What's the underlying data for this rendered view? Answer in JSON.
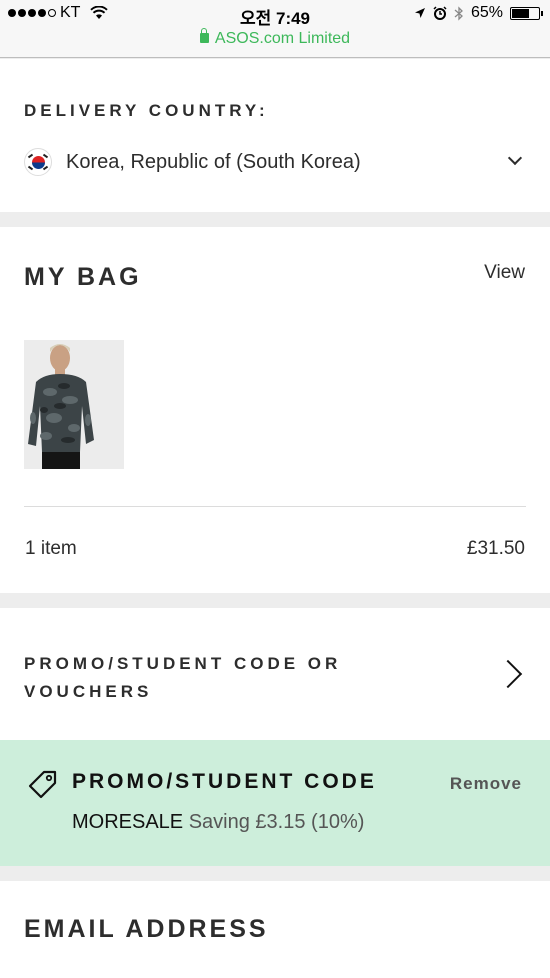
{
  "status_bar": {
    "carrier": "KT",
    "time": "오전 7:49",
    "battery_percent": "65%",
    "battery_level": 0.65,
    "url": "ASOS.com Limited"
  },
  "delivery": {
    "heading": "DELIVERY COUNTRY:",
    "country": "Korea, Republic of (South Korea)",
    "flag_icon": "south-korea-flag-icon",
    "dropdown_icon": "chevron-down-icon"
  },
  "bag": {
    "heading": "MY BAG",
    "view_label": "View",
    "item_count": "1 item",
    "total": "£31.50"
  },
  "promo": {
    "heading": "PROMO/STUDENT CODE OR VOUCHERS",
    "arrow_icon": "chevron-right-icon"
  },
  "applied_code": {
    "title": "PROMO/STUDENT CODE",
    "remove_label": "Remove",
    "code": "MORESALE",
    "saving": "Saving £3.15 (10%)",
    "background_color": "#cdeedb",
    "icon": "tag-icon"
  },
  "email": {
    "heading": "EMAIL ADDRESS"
  }
}
